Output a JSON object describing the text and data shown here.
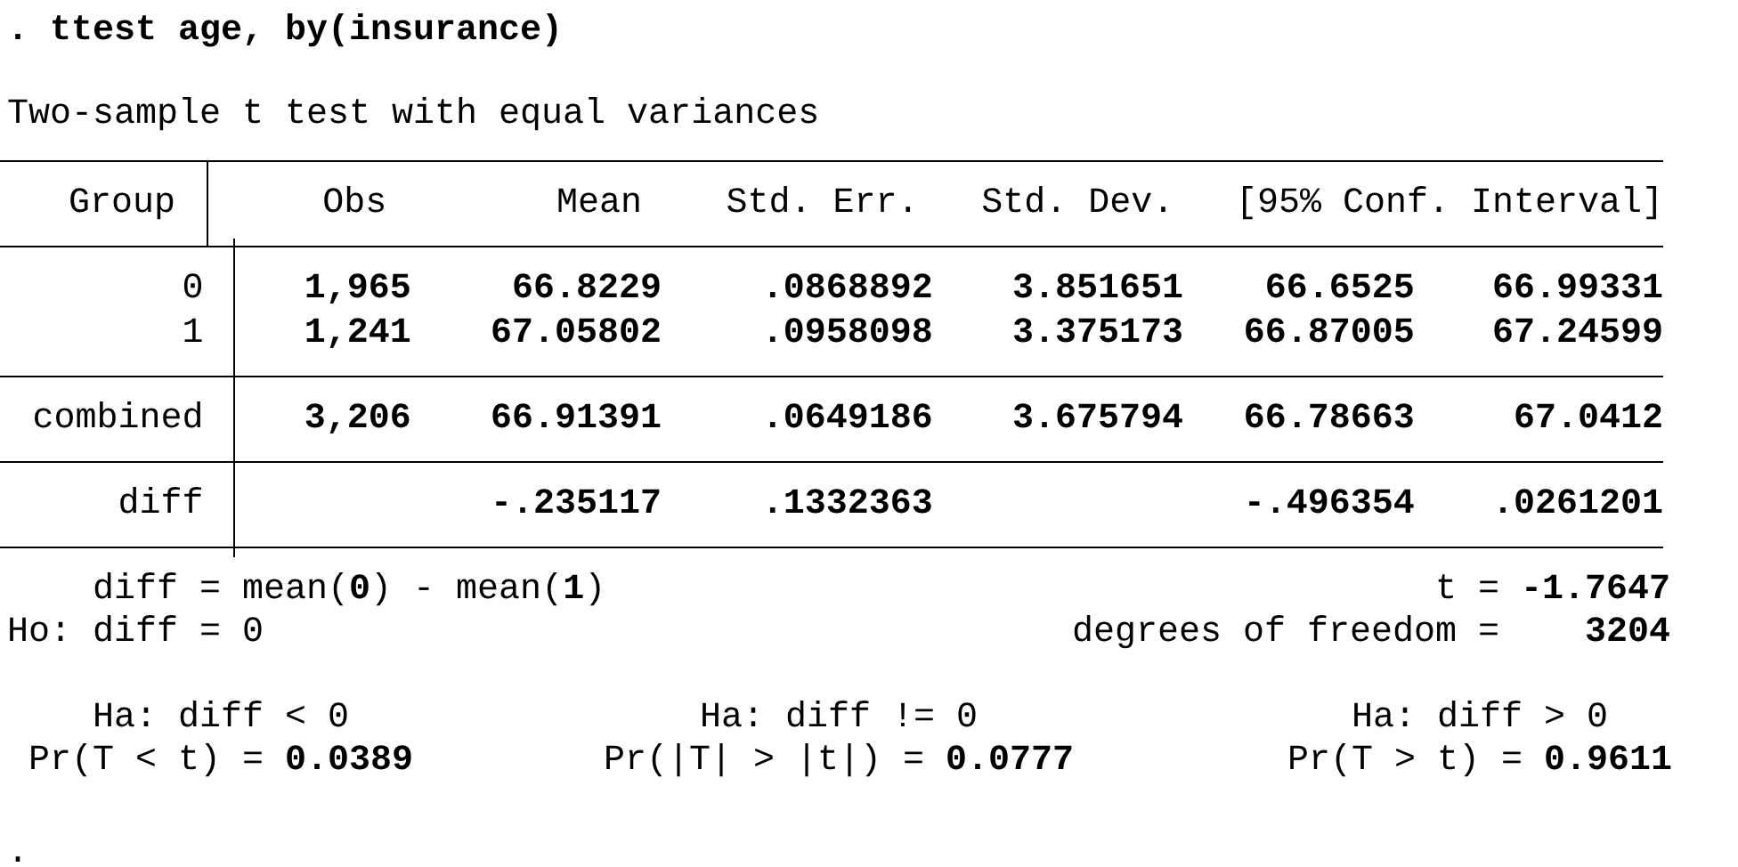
{
  "command": ". ttest age, by(insurance)",
  "title": "Two-sample t test with equal variances",
  "table": {
    "columns": [
      "Group",
      "Obs",
      "Mean",
      "Std. Err.",
      "Std. Dev.",
      "[95% Conf. Interval]"
    ],
    "sections": [
      [
        {
          "group": "0",
          "obs": "1,965",
          "mean": "66.8229",
          "std_err": ".0868892",
          "std_dev": "3.851651",
          "ci_low": "66.6525",
          "ci_high": "66.99331"
        },
        {
          "group": "1",
          "obs": "1,241",
          "mean": "67.05802",
          "std_err": ".0958098",
          "std_dev": "3.375173",
          "ci_low": "66.87005",
          "ci_high": "67.24599"
        }
      ],
      [
        {
          "group": "combined",
          "obs": "3,206",
          "mean": "66.91391",
          "std_err": ".0649186",
          "std_dev": "3.675794",
          "ci_low": "66.78663",
          "ci_high": "67.0412"
        }
      ],
      [
        {
          "group": "diff",
          "mean": "-.235117",
          "std_err": ".1332363",
          "ci_low": "-.496354",
          "ci_high": ".0261201"
        }
      ]
    ]
  },
  "test": {
    "diff_definition": "diff = mean(**0**) - mean(**1**)",
    "t_label": "t =",
    "t_value": "-1.7647",
    "null_hypothesis": "Ho: diff = 0",
    "df_label": "degrees of freedom =",
    "df_value": "3204"
  },
  "alternatives": [
    {
      "hypothesis": "Ha: diff < 0",
      "probability": "Pr(T < t) = **0.0389**"
    },
    {
      "hypothesis": "Ha: diff != 0",
      "probability": "Pr(|T| > |t|) = **0.0777**"
    },
    {
      "hypothesis": "Ha: diff > 0",
      "probability": "Pr(T > t) = **0.9611**"
    }
  ],
  "prompt": "."
}
